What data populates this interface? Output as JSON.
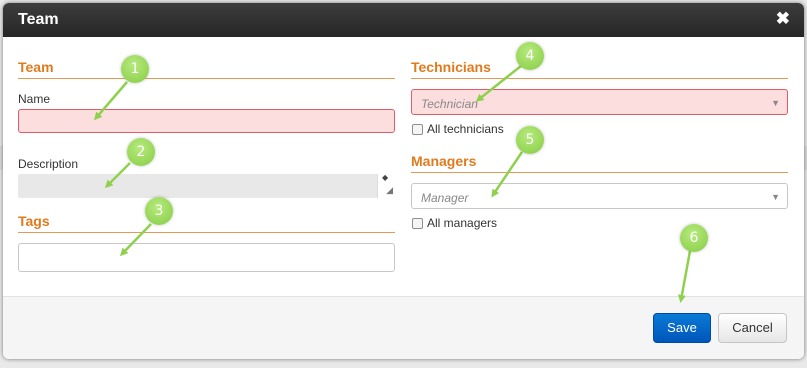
{
  "dialog": {
    "title": "Team",
    "close_glyph": "✖"
  },
  "left": {
    "team_section": "Team",
    "name_label": "Name",
    "name_value": "",
    "description_label": "Description",
    "description_value": "",
    "tags_section": "Tags",
    "tags_value": ""
  },
  "right": {
    "technicians_section": "Technicians",
    "technician_placeholder": "Technician",
    "all_technicians_label": "All technicians",
    "managers_section": "Managers",
    "manager_placeholder": "Manager",
    "all_managers_label": "All managers"
  },
  "footer": {
    "save_label": "Save",
    "cancel_label": "Cancel"
  },
  "callouts": [
    "1",
    "2",
    "3",
    "4",
    "5",
    "6"
  ],
  "colors": {
    "section_orange": "#e07b1d",
    "error_pink": "#fddede",
    "error_border": "#e25c68",
    "save_blue": "#0b6fd0",
    "callout_green": "#8fd14f"
  },
  "icons": {
    "close": "close-icon",
    "dropdown": "chevron-down-icon",
    "resize": "resize-handle-icon"
  }
}
